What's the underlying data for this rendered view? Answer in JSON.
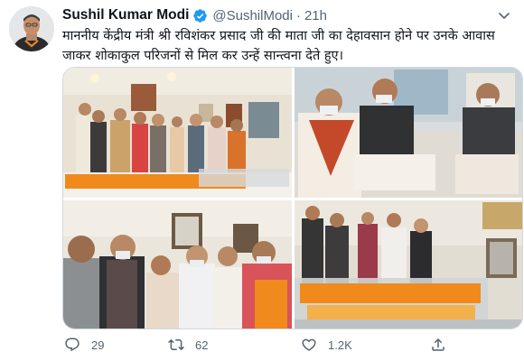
{
  "author": {
    "name": "Sushil Kumar Modi",
    "handle": "@SushilModi",
    "time": "21h",
    "separator": "·"
  },
  "tweet": {
    "text": "माननीय केंद्रीय मंत्री श्री रविशंकर प्रसाद जी की माता जी का देहावसान होने पर उनके आवास जाकर शोकाकुल परिजनों से मिल कर उन्हें सान्त्वना देते हुए।"
  },
  "media": {
    "photos": [
      "photo-1",
      "photo-2",
      "photo-3",
      "photo-4"
    ]
  },
  "actions": {
    "reply_count": "29",
    "retweet_count": "62",
    "like_count": "1.2K"
  },
  "icons": {
    "verified": "verified-badge-icon",
    "more": "chevron-down-icon",
    "reply": "reply-icon",
    "retweet": "retweet-icon",
    "like": "heart-icon",
    "share": "share-icon"
  },
  "colors": {
    "verified": "#1d9bf0",
    "muted": "#536471",
    "text": "#0f1419",
    "border": "#cfd9de"
  }
}
